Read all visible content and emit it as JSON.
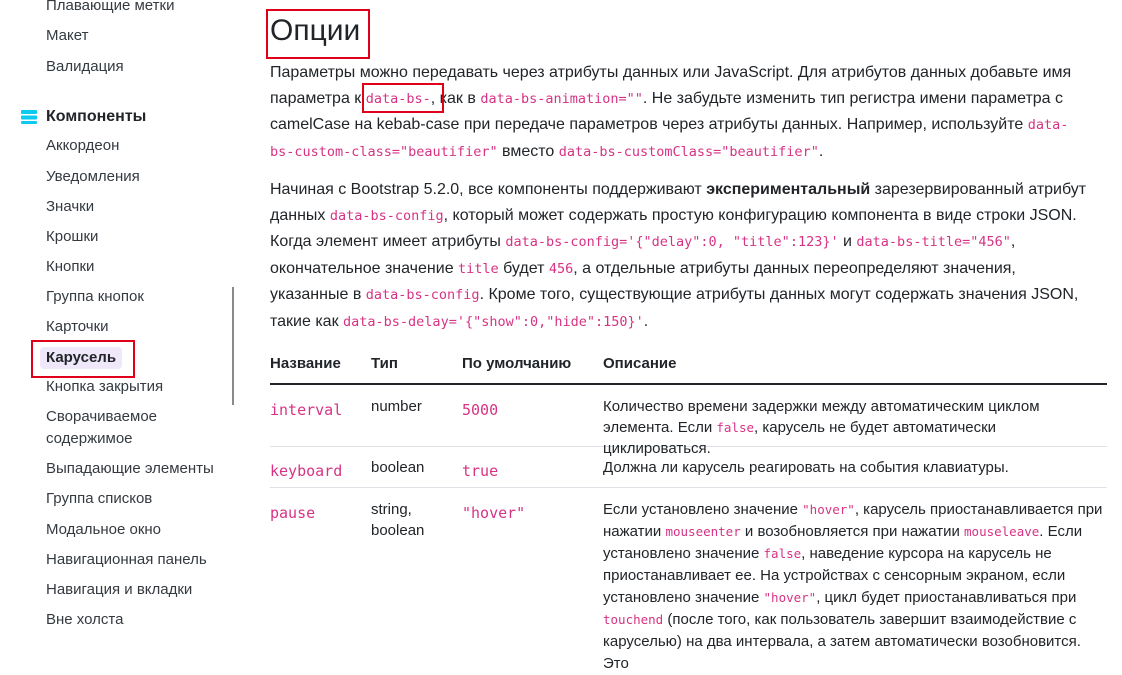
{
  "sidebar": {
    "items_top": [
      "Плавающие метки",
      "Макет",
      "Валидация"
    ],
    "group_label": "Компоненты",
    "items": [
      "Аккордеон",
      "Уведомления",
      "Значки",
      "Крошки",
      "Кнопки",
      "Группа кнопок",
      "Карточки",
      "Карусель",
      "Кнопка закрытия",
      "Сворачиваемое",
      "содержимое",
      "Выпадающие элементы",
      "Группа списков",
      "Модальное окно",
      "Навигационная панель",
      "Навигация и вкладки",
      "Вне холста"
    ],
    "active_item": "Карусель",
    "accent_color": "#6f42c1"
  },
  "main": {
    "title": "Опции",
    "p1": {
      "t1": "Параметры можно передавать через атрибуты данных или JavaScript. Для атрибутов данных добавьте имя параметра к ",
      "c1": "data-bs-",
      "t2": ", как в ",
      "c2": "data-bs-animation=\"\"",
      "t3": ". Не забудьте изменить тип регистра имени параметра с camelCase на kebab-case при передаче параметров через атрибуты данных. Например, используйте ",
      "c3": "data-bs-custom-class=\"beautifier\"",
      "t4": " вместо ",
      "c4": "data-bs-customClass=\"beautifier\"",
      "t5": "."
    },
    "p2": {
      "t1": "Начиная с Bootstrap 5.2.0, все компоненты поддерживают ",
      "b1": "экспериментальный",
      "t2": " зарезервированный атрибут данных ",
      "c1": "data-bs-config",
      "t3": ", который может содержать простую конфигурацию компонента в виде строки JSON. Когда элемент имеет атрибуты ",
      "c2": "data-bs-config='{\"delay\":0, \"title\":123}'",
      "t4": " и ",
      "c3": "data-bs-title=\"456\"",
      "t5": ", окончательное значение ",
      "c4": "title",
      "t6": " будет ",
      "c5": "456",
      "t7": ", а отдельные атрибуты данных переопределяют значения, указанные в ",
      "c6": "data-bs-config",
      "t8": ". Кроме того, существующие атрибуты данных могут содержать значения JSON, такие как ",
      "c7": "data-bs-delay='{\"show\":0,\"hide\":150}'",
      "t9": "."
    },
    "table": {
      "headers": [
        "Название",
        "Тип",
        "По умолчанию",
        "Описание"
      ],
      "rows": [
        {
          "name": "interval",
          "type": "number",
          "default": "5000",
          "d1": "Количество времени задержки между автоматическим циклом элемента. Если ",
          "dc1": "false",
          "d2": ", карусель не будет автоматически циклироваться."
        },
        {
          "name": "keyboard",
          "type": "boolean",
          "default": "true",
          "d1": "Должна ли карусель реагировать на события клавиатуры."
        },
        {
          "name": "pause",
          "type1": "string,",
          "type2": "boolean",
          "default": "\"hover\"",
          "d1": "Если установлено значение ",
          "dc1": "\"hover\"",
          "d2": ", карусель приостанавливается при нажатии ",
          "dc2": "mouseenter",
          "d3": " и возобновляется при нажатии ",
          "dc3": "mouseleave",
          "d4": ". Если установлено значение ",
          "dc4": "false",
          "d5": ", наведение курсора на карусель не приостанавливает ее. На устройствах с сенсорным экраном, если установлено значение ",
          "dc5": "\"hover\"",
          "d6": ", цикл будет приостанавливаться при ",
          "dc6": "touchend",
          "d7": " (после того, как пользователь завершит взаимодействие с каруселью) на два интервала, а затем автоматически возобновится. Это"
        }
      ]
    }
  }
}
